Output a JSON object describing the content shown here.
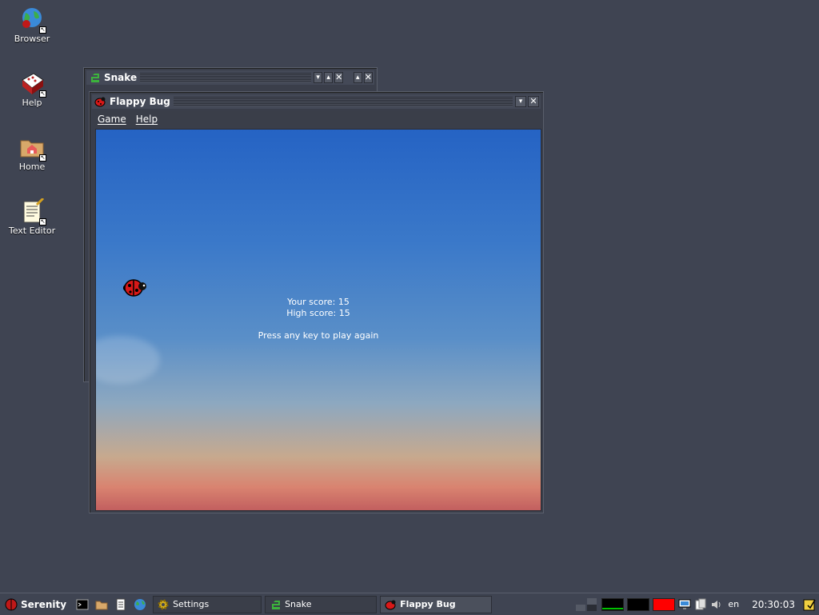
{
  "desktop": {
    "icons": [
      {
        "label": "Browser",
        "icon": "browser-icon"
      },
      {
        "label": "Help",
        "icon": "help-book-icon"
      },
      {
        "label": "Home",
        "icon": "home-folder-icon"
      },
      {
        "label": "Text Editor",
        "icon": "text-editor-icon"
      }
    ]
  },
  "snake_window": {
    "title": "Snake"
  },
  "flappy_window": {
    "title": "Flappy Bug",
    "menu": [
      "Game",
      "Help"
    ],
    "score_line": "Your score: 15",
    "high_score_line": "High score: 15",
    "prompt": "Press any key to play again"
  },
  "taskbar": {
    "start_label": "Serenity",
    "tasks": [
      {
        "label": "Settings",
        "active": false
      },
      {
        "label": "Snake",
        "active": false
      },
      {
        "label": "Flappy Bug",
        "active": true
      }
    ],
    "keyboard_layout": "en",
    "clock": "20:30:03"
  },
  "colors": {
    "desktop": "#3f4452",
    "cpu_graph": "#00c000",
    "memory_graph": "#ff0000"
  }
}
